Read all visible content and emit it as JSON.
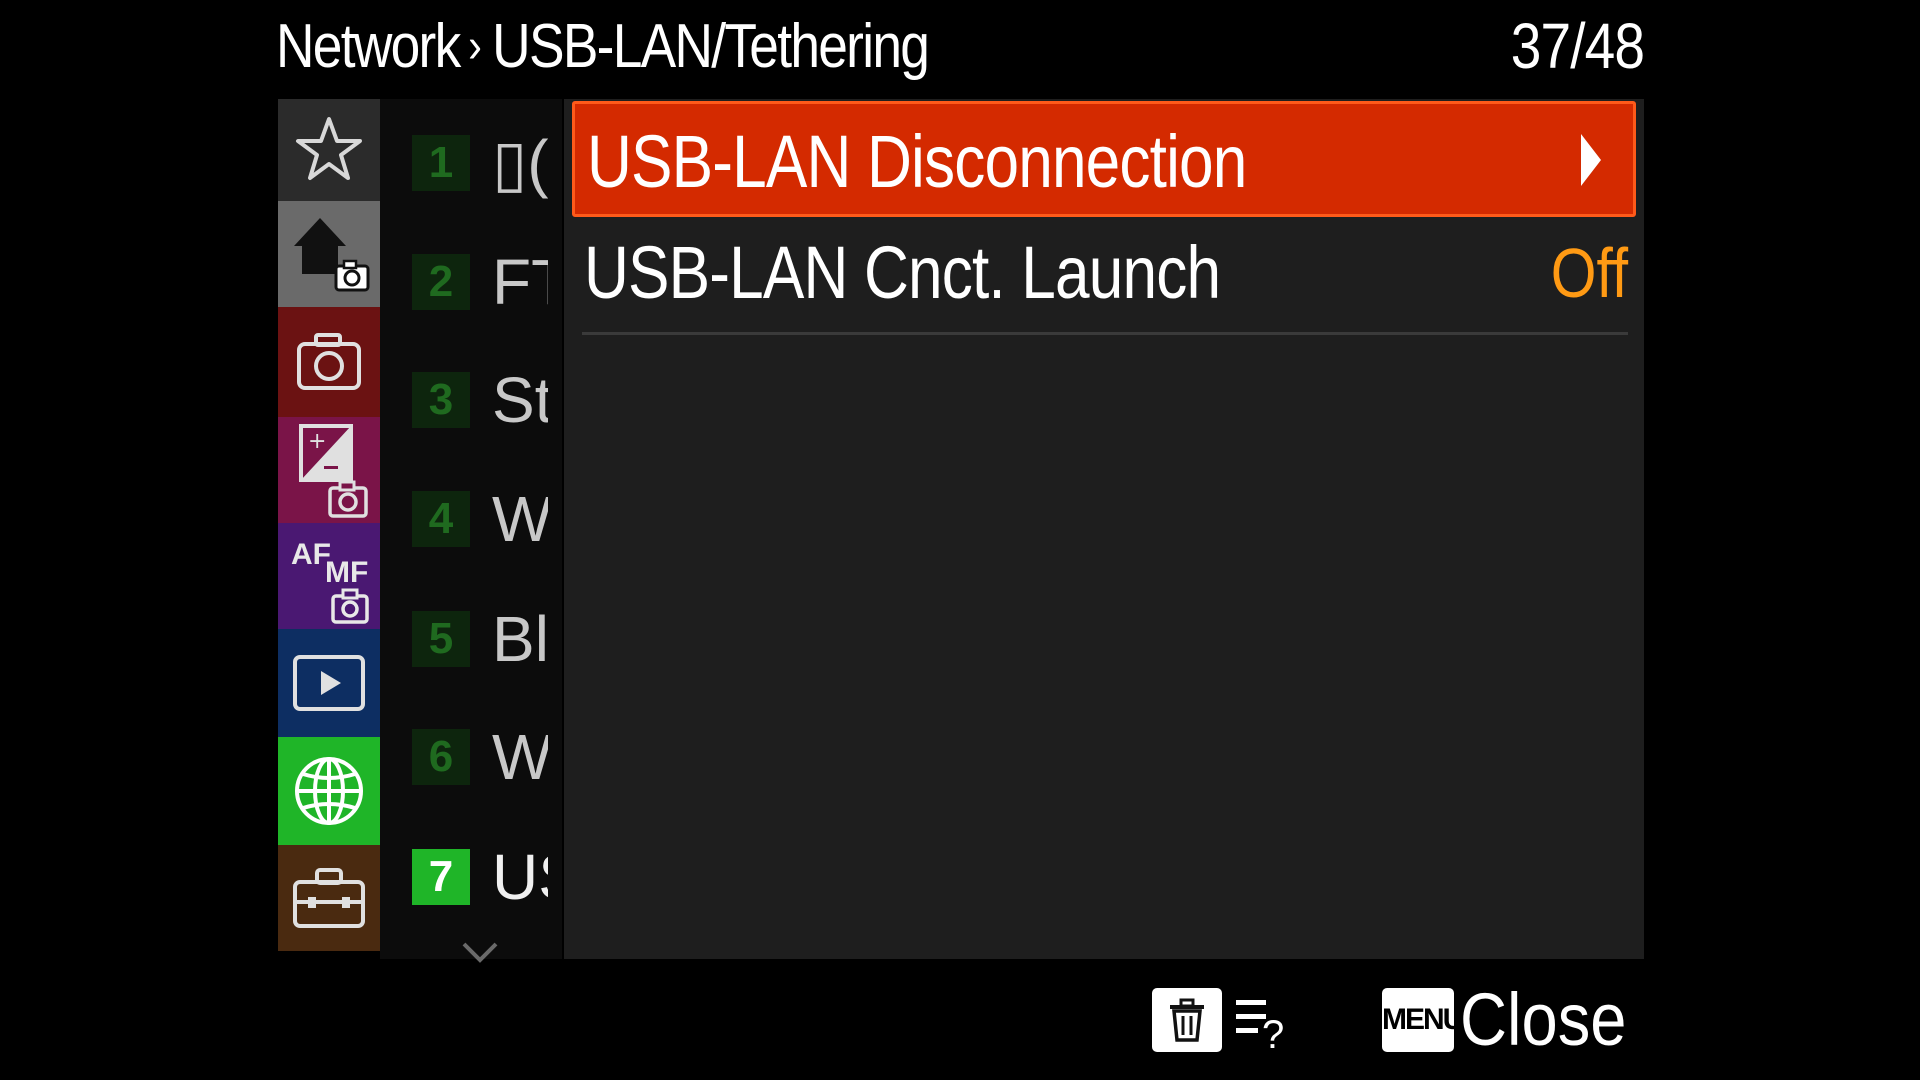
{
  "header": {
    "breadcrumb_parent": "Network",
    "breadcrumb_sep": "›",
    "breadcrumb_current": "USB-LAN/Tethering",
    "page_counter": "37/48"
  },
  "categories": [
    {
      "name": "my-menu",
      "icon": "star-icon",
      "color": "#2b2b2b"
    },
    {
      "name": "main",
      "icon": "home-camera-icon",
      "color": "#6a6a6a"
    },
    {
      "name": "shooting",
      "icon": "camera-icon",
      "color": "#6b1212"
    },
    {
      "name": "exposure-color",
      "icon": "exposure-camera-icon",
      "color": "#7a1448"
    },
    {
      "name": "focus",
      "icon": "af-mf-camera-icon",
      "color": "#4a1872"
    },
    {
      "name": "playback",
      "icon": "play-icon",
      "color": "#0d2e62"
    },
    {
      "name": "network",
      "icon": "globe-icon",
      "color": "#1fb528"
    },
    {
      "name": "setup",
      "icon": "toolbox-icon",
      "color": "#4a2a10"
    }
  ],
  "pages": [
    {
      "num": "1",
      "abbr": "▯("
    },
    {
      "num": "2",
      "abbr": "FT"
    },
    {
      "num": "3",
      "abbr": "St"
    },
    {
      "num": "4",
      "abbr": "W"
    },
    {
      "num": "5",
      "abbr": "Bl"
    },
    {
      "num": "6",
      "abbr": "W"
    },
    {
      "num": "7",
      "abbr": "US"
    }
  ],
  "menu": {
    "items": [
      {
        "label": "USB-LAN Disconnection",
        "value": ""
      },
      {
        "label": "USB-LAN Cnct. Launch",
        "value": "Off"
      }
    ]
  },
  "footer": {
    "delete_icon": "trash-icon",
    "help_icon": "menu-help-icon",
    "menu_badge": "MENU",
    "close_label": "Close"
  },
  "colors": {
    "selected_bg": "#d42a00",
    "value_accent": "#ff9a14",
    "active_page": "#1fb528"
  }
}
